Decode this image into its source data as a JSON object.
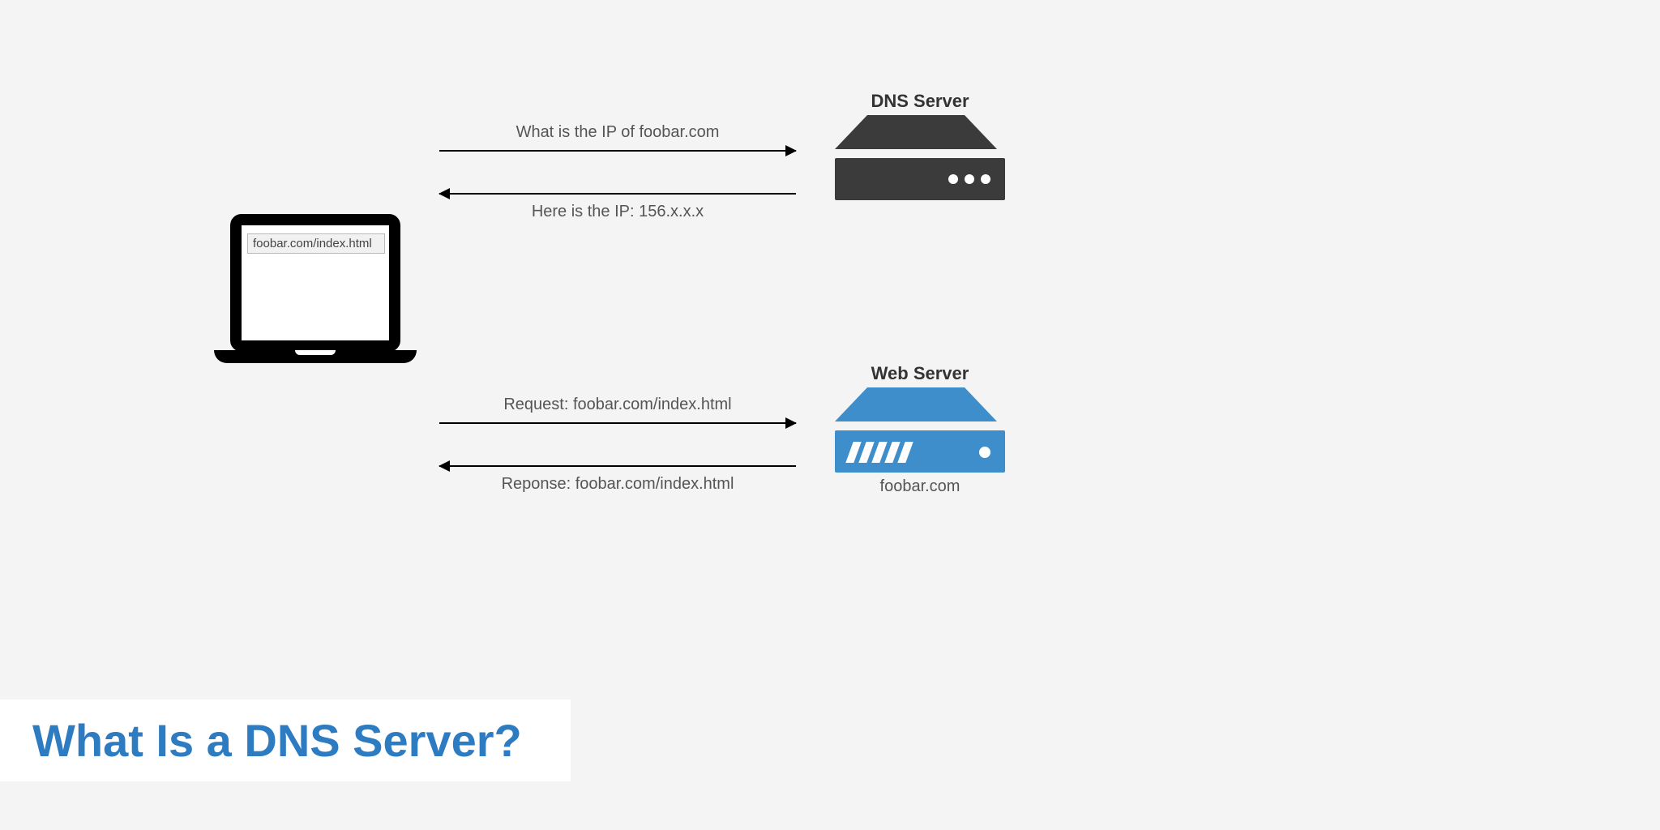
{
  "title": "What Is a DNS Server?",
  "laptop": {
    "address": "foobar.com/index.html"
  },
  "servers": {
    "dns": {
      "label": "DNS Server"
    },
    "web": {
      "label": "Web Server",
      "caption": "foobar.com"
    }
  },
  "arrows": {
    "to_dns": "What is the IP of foobar.com",
    "from_dns": "Here is the IP: 156.x.x.x",
    "to_web": "Request: foobar.com/index.html",
    "from_web": "Reponse: foobar.com/index.html"
  },
  "colors": {
    "accent_blue": "#3e8ecb",
    "server_dark": "#3b3b3b",
    "title_blue": "#2d7bc0"
  }
}
